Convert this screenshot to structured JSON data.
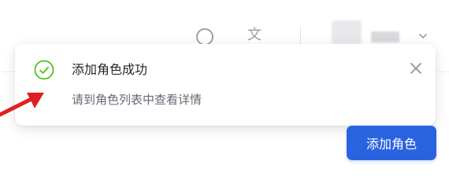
{
  "toast": {
    "title": "添加角色成功",
    "description": "请到角色列表中查看详情",
    "icon": "check-circle-icon",
    "success_color": "#52c41a"
  },
  "header": {
    "help_icon": "question-circle-icon",
    "language_icon": "translate-icon",
    "language_glyph": "文",
    "dropdown_icon": "chevron-down-icon"
  },
  "actions": {
    "add_role_label": "添加角色",
    "primary_color": "#2a63e0"
  },
  "annotation": {
    "arrow_color": "#e02020"
  }
}
